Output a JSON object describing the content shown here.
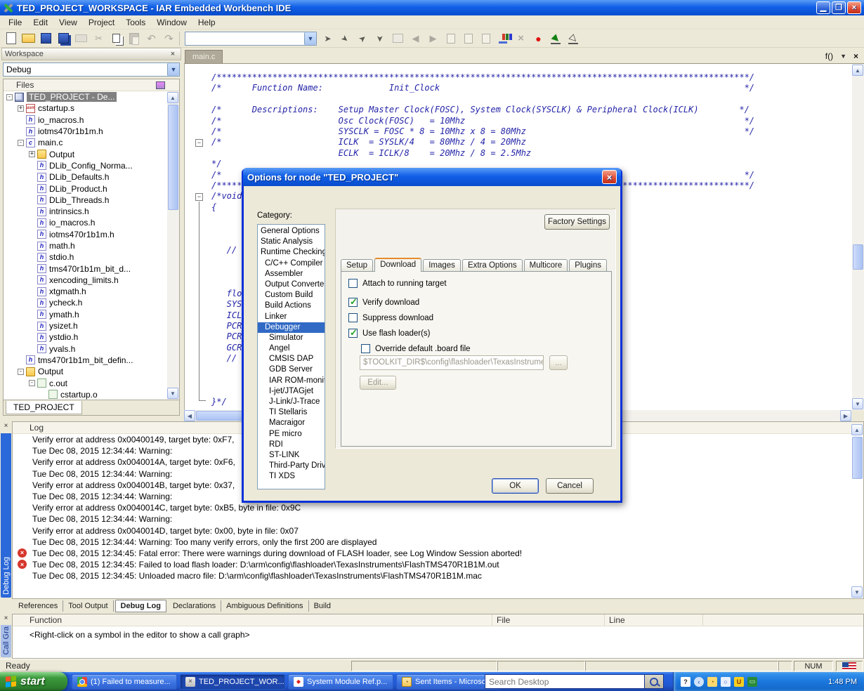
{
  "colors": {
    "titlebar_blue": "#1160e8",
    "selection_blue": "#316ac5",
    "tree_selection_gray": "#808080",
    "taskbar_blue": "#2663e0",
    "error_red": "#d6362c",
    "check_green": "#21a121",
    "code_navy": "#2424a8"
  },
  "window": {
    "title": "TED_PROJECT_WORKSPACE - IAR Embedded Workbench IDE"
  },
  "menu": {
    "items": [
      {
        "label": "File"
      },
      {
        "label": "Edit"
      },
      {
        "label": "View"
      },
      {
        "label": "Project"
      },
      {
        "label": "Tools"
      },
      {
        "label": "Window"
      },
      {
        "label": "Help"
      }
    ]
  },
  "toolbar": {
    "find_value": "",
    "icons1": [
      {
        "name": "new-document-icon",
        "cls": "ti new-document-icon"
      },
      {
        "name": "open-file-icon",
        "cls": "ti open-file-icon"
      },
      {
        "name": "save-icon",
        "cls": "ti save-icon"
      },
      {
        "name": "save-all-icon",
        "cls": "ti save-all-icon"
      },
      {
        "name": "print-icon",
        "cls": "ti print-icon dim"
      },
      {
        "name": "cut-icon",
        "cls": "ti cut-icon dim"
      },
      {
        "name": "copy-icon",
        "cls": "ti copy-icon"
      },
      {
        "name": "paste-icon",
        "cls": "ti paste-icon dim"
      },
      {
        "name": "undo-icon",
        "cls": "ti undo-icon dim"
      },
      {
        "name": "redo-icon",
        "cls": "ti redo-icon dim"
      }
    ],
    "icons2": [
      {
        "name": "toggle-bookmark-icon",
        "cls": "ti nav-icon"
      },
      {
        "name": "previous-bookmark-icon",
        "cls": "ti nav-icon nav2"
      },
      {
        "name": "next-bookmark-icon",
        "cls": "ti nav-icon nav3"
      },
      {
        "name": "clear-bookmarks-icon",
        "cls": "ti nav-icon nav4"
      },
      {
        "name": "browse-window-icon",
        "cls": "ti browse-window-icon dim"
      },
      {
        "name": "navigate-backward-icon",
        "cls": "ti back-icon dim"
      },
      {
        "name": "navigate-forward-icon",
        "cls": "ti fwd-icon dim"
      },
      {
        "name": "open-header-icon",
        "cls": "ti doc-arrow-icon dim"
      },
      {
        "name": "goto-include-icon",
        "cls": "ti doc-arrow-icon dim"
      },
      {
        "name": "compile-icon",
        "cls": "ti doc-arrow-icon dim"
      },
      {
        "name": "make-icon",
        "cls": "ti make-icon"
      },
      {
        "name": "stop-build-icon",
        "cls": "ti stop-build-icon dim"
      },
      {
        "name": "toggle-breakpoint-icon",
        "cls": "ti breakpoint-icon"
      },
      {
        "name": "download-and-debug-icon",
        "cls": "ti dl-debug-icon"
      },
      {
        "name": "debug-without-downloading-icon",
        "cls": "ti debug-nd-icon"
      }
    ]
  },
  "workspace": {
    "title": "Workspace",
    "target_select": "Debug",
    "files_header": "Files",
    "project_tab": "TED_PROJECT",
    "tree": [
      {
        "label": "TED_PROJECT - De...",
        "icon": "icon-project",
        "indent": 0,
        "expand": "-",
        "cls": "selected"
      },
      {
        "label": "cstartup.s",
        "icon": "icon-asm",
        "indent": 1,
        "expand": "+",
        "glyph": "asm"
      },
      {
        "label": "io_macros.h",
        "icon": "icon-h",
        "indent": 1,
        "expand": "",
        "glyph": "h"
      },
      {
        "label": "iotms470r1b1m.h",
        "icon": "icon-h",
        "indent": 1,
        "expand": "",
        "glyph": "h"
      },
      {
        "label": "main.c",
        "icon": "icon-c",
        "indent": 1,
        "expand": "-",
        "glyph": "c"
      },
      {
        "label": "Output",
        "icon": "icon-folder",
        "indent": 2,
        "expand": "+",
        "glyph": ""
      },
      {
        "label": "DLib_Config_Norma...",
        "icon": "icon-h",
        "indent": 2,
        "expand": "",
        "glyph": "h"
      },
      {
        "label": "DLib_Defaults.h",
        "icon": "icon-h",
        "indent": 2,
        "expand": "",
        "glyph": "h"
      },
      {
        "label": "DLib_Product.h",
        "icon": "icon-h",
        "indent": 2,
        "expand": "",
        "glyph": "h"
      },
      {
        "label": "DLib_Threads.h",
        "icon": "icon-h",
        "indent": 2,
        "expand": "",
        "glyph": "h"
      },
      {
        "label": "intrinsics.h",
        "icon": "icon-h",
        "indent": 2,
        "expand": "",
        "glyph": "h"
      },
      {
        "label": "io_macros.h",
        "icon": "icon-h",
        "indent": 2,
        "expand": "",
        "glyph": "h"
      },
      {
        "label": "iotms470r1b1m.h",
        "icon": "icon-h",
        "indent": 2,
        "expand": "",
        "glyph": "h"
      },
      {
        "label": "math.h",
        "icon": "icon-h",
        "indent": 2,
        "expand": "",
        "glyph": "h"
      },
      {
        "label": "stdio.h",
        "icon": "icon-h",
        "indent": 2,
        "expand": "",
        "glyph": "h"
      },
      {
        "label": "tms470r1b1m_bit_d...",
        "icon": "icon-h",
        "indent": 2,
        "expand": "",
        "glyph": "h"
      },
      {
        "label": "xencoding_limits.h",
        "icon": "icon-h",
        "indent": 2,
        "expand": "",
        "glyph": "h"
      },
      {
        "label": "xtgmath.h",
        "icon": "icon-h",
        "indent": 2,
        "expand": "",
        "glyph": "h"
      },
      {
        "label": "ycheck.h",
        "icon": "icon-h",
        "indent": 2,
        "expand": "",
        "glyph": "h"
      },
      {
        "label": "ymath.h",
        "icon": "icon-h",
        "indent": 2,
        "expand": "",
        "glyph": "h"
      },
      {
        "label": "ysizet.h",
        "icon": "icon-h",
        "indent": 2,
        "expand": "",
        "glyph": "h"
      },
      {
        "label": "ystdio.h",
        "icon": "icon-h",
        "indent": 2,
        "expand": "",
        "glyph": "h"
      },
      {
        "label": "yvals.h",
        "icon": "icon-h",
        "indent": 2,
        "expand": "",
        "glyph": "h"
      },
      {
        "label": "tms470r1b1m_bit_defin...",
        "icon": "icon-h",
        "indent": 1,
        "expand": "",
        "glyph": "h"
      },
      {
        "label": "Output",
        "icon": "icon-folder",
        "indent": 1,
        "expand": "-",
        "glyph": ""
      },
      {
        "label": "c.out",
        "icon": "icon-out",
        "indent": 2,
        "expand": "-",
        "glyph": ""
      },
      {
        "label": "cstartup.o",
        "icon": "icon-obj",
        "indent": 3,
        "expand": "",
        "glyph": ""
      }
    ]
  },
  "editor": {
    "tab": "main.c",
    "function_selector": "f()",
    "code_lines": [
      {
        "t": "/*********************************************************************************************************/"
      },
      {
        "t": "/*      Function Name:             Init_Clock                                                            */"
      },
      {
        "t": ""
      },
      {
        "t": "/*      Descriptions:    Setup Master Clock(FOSC), System Clock(SYSCLK) & Peripheral Clock(ICLK)        */"
      },
      {
        "t": "/*                       Osc Clock(FOSC)   = 10Mhz                                                       */"
      },
      {
        "t": "/*                       SYSCLK = FOSC * 8 = 10Mhz x 8 = 80Mhz                                           */"
      },
      {
        "t": "/*                       ICLK  = SYSLK/4   = 80Mhz / 4 = 20Mhz"
      },
      {
        "t": "                         ECLK  = ICLK/8    = 20Mhz / 8 = 2.5Mhz"
      },
      {
        "t": "*/"
      },
      {
        "t": "/*                                                                                                       */"
      },
      {
        "t": "/*********************************************************************************************************/"
      },
      {
        "t": "/*void"
      },
      {
        "t": "{"
      },
      {
        "t": ""
      },
      {
        "t": ""
      },
      {
        "t": ""
      },
      {
        "t": "   // Co"
      },
      {
        "t": ""
      },
      {
        "t": ""
      },
      {
        "t": ""
      },
      {
        "t": "   floa"
      },
      {
        "t": "   SYSC"
      },
      {
        "t": "   ICLK"
      },
      {
        "t": "   PCR"
      },
      {
        "t": "   PCR"
      },
      {
        "t": "   GCR"
      },
      {
        "t": "   // GC"
      },
      {
        "t": ""
      },
      {
        "t": ""
      },
      {
        "t": ""
      },
      {
        "t": "}*/"
      }
    ]
  },
  "options_dialog": {
    "title": "Options for node \"TED_PROJECT\"",
    "category_label": "Category:",
    "factory_settings_label": "Factory Settings",
    "categories": [
      {
        "label": "General Options",
        "indent": 0,
        "cls": ""
      },
      {
        "label": "Static Analysis",
        "indent": 0,
        "cls": ""
      },
      {
        "label": "Runtime Checking",
        "indent": 0,
        "cls": ""
      },
      {
        "label": "C/C++ Compiler",
        "indent": 1,
        "cls": ""
      },
      {
        "label": "Assembler",
        "indent": 1,
        "cls": ""
      },
      {
        "label": "Output Converter",
        "indent": 1,
        "cls": ""
      },
      {
        "label": "Custom Build",
        "indent": 1,
        "cls": ""
      },
      {
        "label": "Build Actions",
        "indent": 1,
        "cls": ""
      },
      {
        "label": "Linker",
        "indent": 1,
        "cls": ""
      },
      {
        "label": "Debugger",
        "indent": 1,
        "cls": "selected"
      },
      {
        "label": "Simulator",
        "indent": 2,
        "cls": ""
      },
      {
        "label": "Angel",
        "indent": 2,
        "cls": ""
      },
      {
        "label": "CMSIS DAP",
        "indent": 2,
        "cls": ""
      },
      {
        "label": "GDB Server",
        "indent": 2,
        "cls": ""
      },
      {
        "label": "IAR ROM-monitor",
        "indent": 2,
        "cls": ""
      },
      {
        "label": "I-jet/JTAGjet",
        "indent": 2,
        "cls": ""
      },
      {
        "label": "J-Link/J-Trace",
        "indent": 2,
        "cls": ""
      },
      {
        "label": "TI Stellaris",
        "indent": 2,
        "cls": ""
      },
      {
        "label": "Macraigor",
        "indent": 2,
        "cls": ""
      },
      {
        "label": "PE micro",
        "indent": 2,
        "cls": ""
      },
      {
        "label": "RDI",
        "indent": 2,
        "cls": ""
      },
      {
        "label": "ST-LINK",
        "indent": 2,
        "cls": ""
      },
      {
        "label": "Third-Party Driver",
        "indent": 2,
        "cls": ""
      },
      {
        "label": "TI XDS",
        "indent": 2,
        "cls": ""
      }
    ],
    "tabs": [
      {
        "label": "Setup",
        "cls": ""
      },
      {
        "label": "Download",
        "cls": "active"
      },
      {
        "label": "Images",
        "cls": ""
      },
      {
        "label": "Extra Options",
        "cls": ""
      },
      {
        "label": "Multicore",
        "cls": ""
      },
      {
        "label": "Plugins",
        "cls": ""
      }
    ],
    "checkboxes": [
      {
        "label": "Attach to running target",
        "box": "",
        "cls": "gap",
        "indent": 0
      },
      {
        "label": "Verify download",
        "box": "checked",
        "cls": "",
        "indent": 0
      },
      {
        "label": "Suppress download",
        "box": "",
        "cls": "",
        "indent": 0
      },
      {
        "label": "Use flash loader(s)",
        "box": "checked",
        "cls": "",
        "indent": 0
      },
      {
        "label": "Override default .board file",
        "box": "",
        "cls": "",
        "indent": 1
      }
    ],
    "board_file_value": "$TOOLKIT_DIR$\\config\\flashloader\\TexasInstrume",
    "browse_label": "...",
    "edit_label": "Edit...",
    "ok_label": "OK",
    "cancel_label": "Cancel"
  },
  "log": {
    "header": "Log",
    "side_tab": "Debug Log",
    "lines": [
      {
        "text": "Verify error at address 0x00400149, target byte: 0xF7,",
        "cls": ""
      },
      {
        "text": "Tue Dec 08, 2015 12:34:44: Warning:",
        "cls": ""
      },
      {
        "text": "Verify error at address 0x0040014A, target byte: 0xF6,",
        "cls": ""
      },
      {
        "text": "Tue Dec 08, 2015 12:34:44: Warning:",
        "cls": ""
      },
      {
        "text": "Verify error at address 0x0040014B, target byte: 0x37,",
        "cls": ""
      },
      {
        "text": "Tue Dec 08, 2015 12:34:44: Warning:",
        "cls": ""
      },
      {
        "text": "Verify error at address 0x0040014C, target byte: 0xB5, byte in file: 0x9C",
        "cls": ""
      },
      {
        "text": "Tue Dec 08, 2015 12:34:44: Warning:",
        "cls": ""
      },
      {
        "text": "Verify error at address 0x0040014D, target byte: 0x00, byte in file: 0x07",
        "cls": ""
      },
      {
        "text": "Tue Dec 08, 2015 12:34:44: Warning: Too many verify errors, only the first 200 are displayed",
        "cls": ""
      },
      {
        "text": "Tue Dec 08, 2015 12:34:45: Fatal error: There were warnings during download of FLASH loader, see Log Window  Session aborted!",
        "cls": "error"
      },
      {
        "text": "Tue Dec 08, 2015 12:34:45: Failed to load flash loader: D:\\arm\\config\\flashloader\\TexasInstruments\\FlashTMS470R1B1M.out",
        "cls": "error"
      },
      {
        "text": "Tue Dec 08, 2015 12:34:45: Unloaded macro file: D:\\arm\\config\\flashloader\\TexasInstruments\\FlashTMS470R1B1M.mac",
        "cls": ""
      }
    ]
  },
  "bottom_tabs": [
    {
      "label": "References",
      "cls": ""
    },
    {
      "label": "Tool Output",
      "cls": ""
    },
    {
      "label": "Debug Log",
      "cls": "active"
    },
    {
      "label": "Declarations",
      "cls": ""
    },
    {
      "label": "Ambiguous Definitions",
      "cls": ""
    },
    {
      "label": "Build",
      "cls": ""
    }
  ],
  "call_graph": {
    "side_tab": "Call Gra",
    "columns": {
      "function": "Function",
      "file": "File",
      "line": "Line"
    },
    "message": "<Right-click on a symbol in the editor to show a call graph>"
  },
  "status": {
    "ready": "Ready",
    "num": "NUM"
  },
  "taskbar": {
    "start_label": "start",
    "search_placeholder": "Search Desktop",
    "time": "1:48 PM",
    "tasks": [
      {
        "label": "(1) Failed to measure...",
        "icon": "chrome-icon",
        "cls": ""
      },
      {
        "label": "TED_PROJECT_WOR...",
        "icon": "iar-icon",
        "cls": "active"
      },
      {
        "label": "System Module Ref.p...",
        "icon": "acrobat-icon",
        "cls": ""
      },
      {
        "label": "Sent Items - Microsof...",
        "icon": "outlook-icon",
        "cls": ""
      }
    ],
    "tray_icons": [
      {
        "name": "help-tray-icon",
        "cls": "t-help",
        "g": "?"
      },
      {
        "name": "chevron-tray-icon",
        "cls": "t-chevron",
        "g": "‹"
      },
      {
        "name": "outlook-tray-icon",
        "cls": "t-outlook",
        "g": "◔"
      },
      {
        "name": "search-tray-icon",
        "cls": "t-search",
        "g": "○"
      },
      {
        "name": "antivirus-tray-icon",
        "cls": "t-av",
        "g": "U"
      },
      {
        "name": "network-tray-icon",
        "cls": "t-net",
        "g": "▭"
      }
    ]
  }
}
